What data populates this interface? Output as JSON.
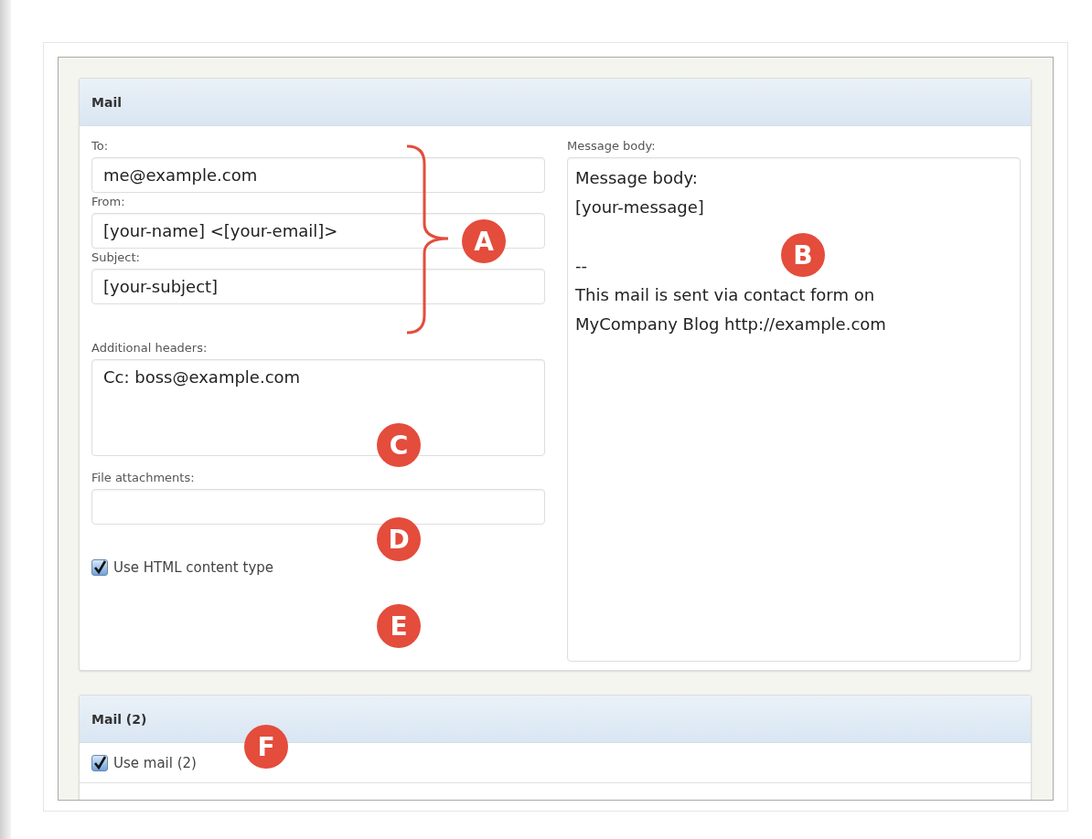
{
  "mail": {
    "title": "Mail",
    "address_group": {
      "badge": "A",
      "fields": [
        {
          "label": "To:",
          "value": "me@example.com"
        },
        {
          "label": "From:",
          "value": "[your-name] <[your-email]>"
        },
        {
          "label": "Subject:",
          "value": "[your-subject]"
        }
      ]
    },
    "additional_headers": {
      "label": "Additional headers:",
      "value": "Cc: boss@example.com",
      "badge": "C"
    },
    "file_attachments": {
      "label": "File attachments:",
      "badge": "D"
    },
    "html_content": {
      "label": "Use HTML content type",
      "checked": true,
      "badge": "E"
    },
    "message_body": {
      "label": "Message body:",
      "value": "Message body:\n[your-message]\n\n--\nThis mail is sent via contact form on\nMyCompany Blog http://example.com",
      "badge": "B"
    }
  },
  "mail2": {
    "title": "Mail (2)",
    "use_mail": {
      "label": "Use mail (2)",
      "checked": true,
      "badge": "F"
    }
  }
}
